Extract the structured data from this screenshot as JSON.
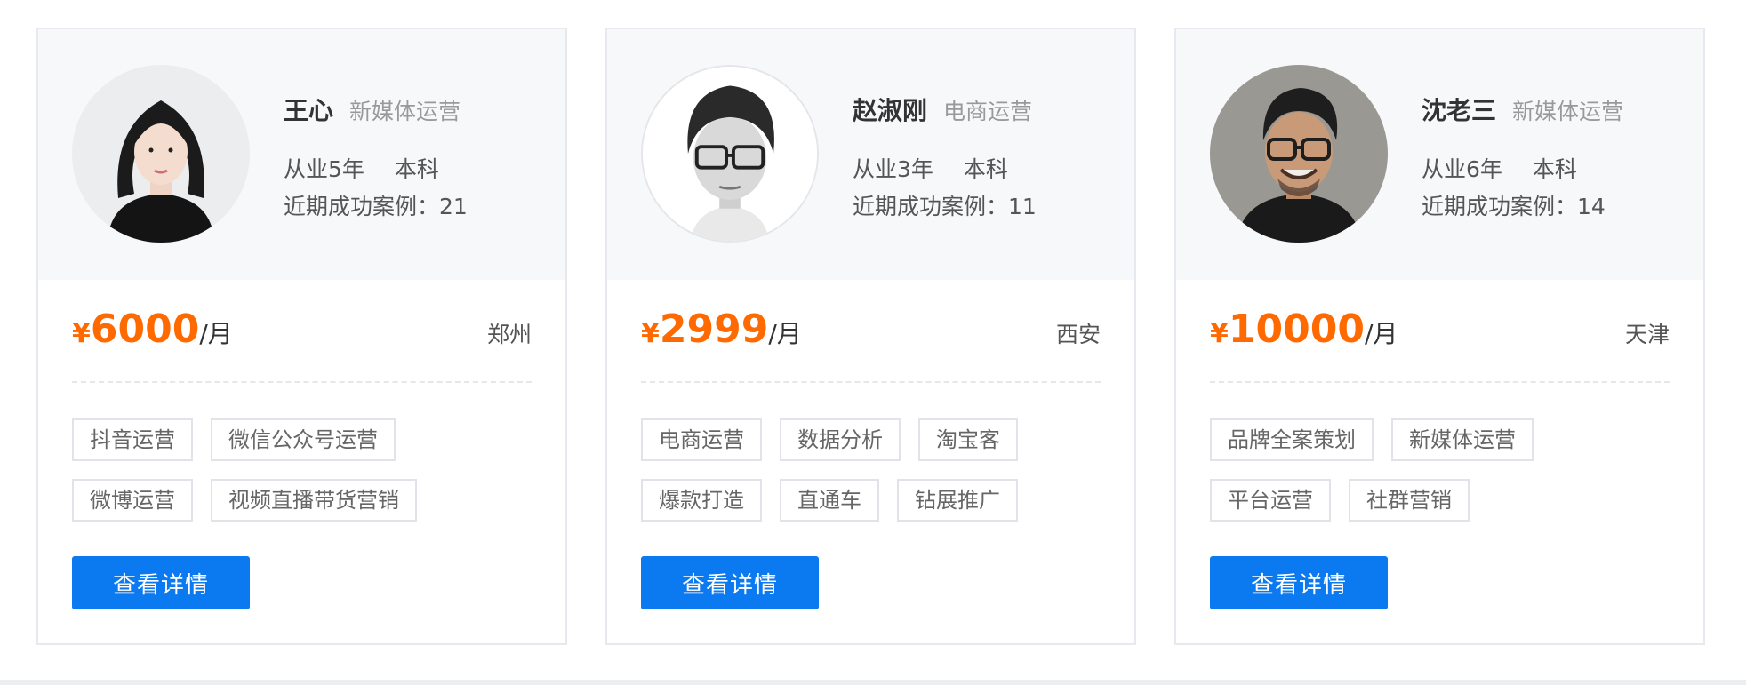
{
  "cards": [
    {
      "name": "王心",
      "role": "新媒体运营",
      "experience": "从业5年",
      "education": "本科",
      "cases": "近期成功案例：21",
      "currency": "¥",
      "price": "6000",
      "unit": "/月",
      "city": "郑州",
      "tags": [
        "抖音运营",
        "微信公众号运营",
        "微博运营",
        "视频直播带货营销"
      ],
      "button": "查看详情"
    },
    {
      "name": "赵淑刚",
      "role": "电商运营",
      "experience": "从业3年",
      "education": "本科",
      "cases": "近期成功案例：11",
      "currency": "¥",
      "price": "2999",
      "unit": "/月",
      "city": "西安",
      "tags": [
        "电商运营",
        "数据分析",
        "淘宝客",
        "爆款打造",
        "直通车",
        "钻展推广"
      ],
      "button": "查看详情"
    },
    {
      "name": "沈老三",
      "role": "新媒体运营",
      "experience": "从业6年",
      "education": "本科",
      "cases": "近期成功案例：14",
      "currency": "¥",
      "price": "10000",
      "unit": "/月",
      "city": "天津",
      "tags": [
        "品牌全案策划",
        "新媒体运营",
        "平台运营",
        "社群营销"
      ],
      "button": "查看详情"
    }
  ],
  "colors": {
    "accent_price": "#ff6a00",
    "button_blue": "#0b7af0",
    "card_header_bg": "#f7f8fa"
  }
}
